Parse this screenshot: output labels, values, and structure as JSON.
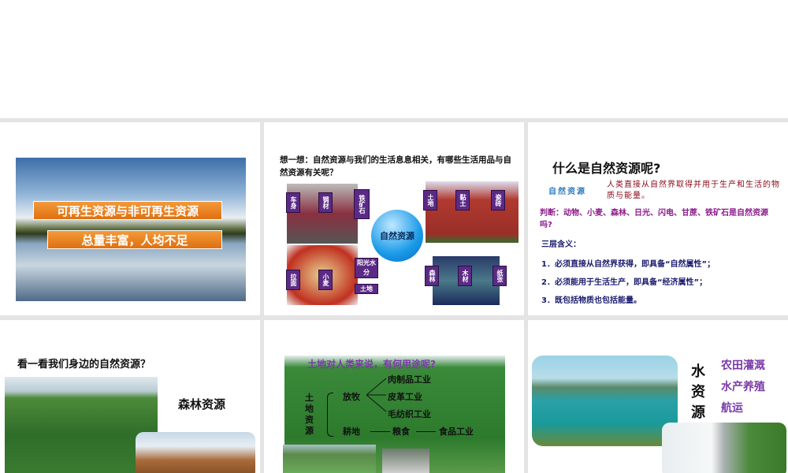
{
  "slides": [
    {
      "labels": [
        "可再生资源与非可再生资源",
        "总量丰富，人均不足"
      ]
    },
    {
      "title": "想一想：自然资源与我们的生活息息相关，有哪些生活用品与自然资源有关呢？",
      "center": "自然资源",
      "boxes": [
        "车身",
        "钢材",
        "铁矿石",
        "土地",
        "黏土",
        "瓷砖",
        "拉面",
        "小麦",
        "阳光水分",
        "土地",
        "森林",
        "木材",
        "纸张"
      ]
    },
    {
      "title": "什么是自然资源呢?",
      "term": "自然资源",
      "definition": "人类直接从自然界取得并用于生产和生活的物质与能量。",
      "question": "判断：动物、小麦、森林、日光、闪电、甘蔗、铁矿石是自然资源吗?",
      "subtitle": "三层含义：",
      "points": [
        "1．必须直接从自然界获得，即具备“自然属性”；",
        "2．必须能用于生活生产，即具备“经济属性”；",
        "3．既包括物质也包括能量。"
      ]
    },
    {
      "title": "看一看我们身边的自然资源？",
      "label": "森林资源"
    },
    {
      "title": "土地对人类来说，有何用途呢?",
      "root": "土地资源",
      "branches": [
        "放牧",
        "耕地"
      ],
      "products": [
        "肉制品工业",
        "皮革工业",
        "毛纺织工业",
        "粮食",
        "食品工业"
      ]
    },
    {
      "label": "水资源",
      "uses": [
        "农田灌溉",
        "水产养殖",
        "航运"
      ]
    }
  ],
  "colors": {
    "purple": "#5b2a86",
    "orange": "#ee8526",
    "navy": "#1a1a6e",
    "maroon": "#8b0a1a",
    "magenta": "#8b1a8b"
  }
}
